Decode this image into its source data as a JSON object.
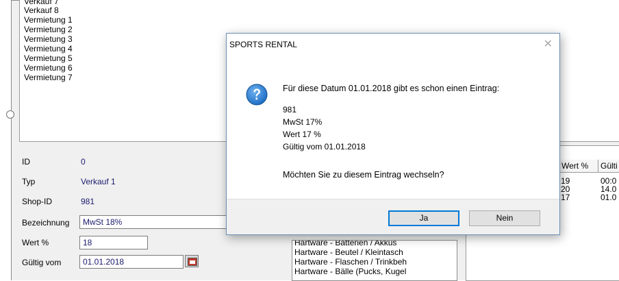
{
  "type_list": {
    "items": [
      "Verkauf 7",
      "Verkauf 8",
      "Vermietung 1",
      "Vermietung 2",
      "Vermietung 3",
      "Vermietung 4",
      "Vermietung 5",
      "Vermietung 6",
      "Vermietung 7"
    ]
  },
  "form": {
    "id_label": "ID",
    "id_value": "0",
    "typ_label": "Typ",
    "typ_value": "Verkauf 1",
    "shop_label": "Shop-ID",
    "shop_value": "981",
    "bez_label": "Bezeichnung",
    "bez_value": "MwSt 18%",
    "wert_label": "Wert %",
    "wert_value": "18",
    "gueltig_label": "Gültig vom",
    "gueltig_value": "01.01.2018"
  },
  "category_list": {
    "items": [
      "Hartware - Batterien / Akkus",
      "Hartware - Beutel / Kleintasch",
      "Hartware - Flaschen / Trinkbeh",
      "Hartware - Bälle (Pucks, Kugel"
    ]
  },
  "grid": {
    "headers": [
      "Wert %",
      "Gülti"
    ],
    "rows": [
      [
        "19",
        "00:0"
      ],
      [
        "20",
        "14.0"
      ],
      [
        "17",
        "01.0"
      ]
    ]
  },
  "dialog": {
    "title": "SPORTS RENTAL",
    "close_glyph": "✕",
    "message": "Für diese Datum 01.01.2018 gibt es schon einen Eintrag:",
    "detail_lines": [
      "981",
      "MwSt 17%",
      "Wert 17 %",
      "Gültig vom 01.01.2018"
    ],
    "question": "Möchten Sie zu diesem Eintrag wechseln?",
    "yes_label": "Ja",
    "no_label": "Nein"
  },
  "icons": {
    "dialog_icon": "question-icon",
    "calendar": "calendar-icon"
  },
  "colors": {
    "value_text": "#1a1a6e",
    "question_icon": "#1f6fc5",
    "dialog_border": "#6b8fb5"
  }
}
